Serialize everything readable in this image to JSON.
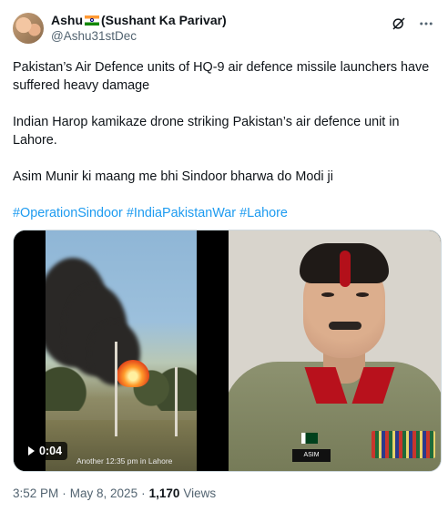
{
  "author": {
    "name_prefix": "Ashu",
    "name_suffix": "(Sushant Ka Parivar)",
    "handle": "@Ashu31stDec"
  },
  "tweet": {
    "paragraph_1": "Pakistan’s Air Defence units of HQ-9 air defence missile launchers have suffered heavy damage",
    "paragraph_2": "Indian Harop kamikaze drone striking Pakistan’s air defence unit in Lahore.",
    "paragraph_3": "Asim Munir ki maang me bhi Sindoor bharwa do Modi ji",
    "hashtags": [
      "#OperationSindoor",
      "#IndiaPakistanWar",
      "#Lahore"
    ]
  },
  "media": {
    "video_duration": "0:04",
    "video_watermark": "Another 12:35 pm in Lahore",
    "photo_nametag": "ASIM"
  },
  "meta": {
    "time": "3:52 PM",
    "date": "May 8, 2025",
    "views_count": "1,170",
    "views_label": "Views",
    "separator": "·"
  },
  "colors": {
    "link": "#1d9bf0",
    "secondary_text": "#536471",
    "primary_text": "#0f1419"
  },
  "icons": [
    "grok-icon",
    "more-options-icon",
    "play-icon",
    "india-flag-icon"
  ]
}
